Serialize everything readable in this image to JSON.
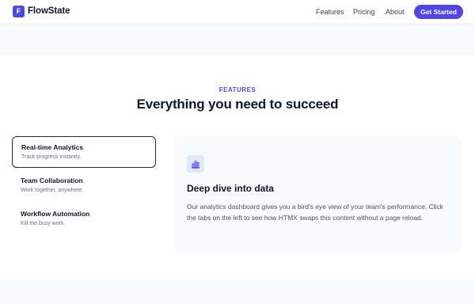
{
  "colors": {
    "accent": "#4f46e5",
    "accent_soft": "#e0e7ff",
    "text_dark": "#0f172a",
    "text_muted": "#64748b"
  },
  "nav": {
    "logo_letter": "F",
    "brand": "FlowState",
    "links": [
      "Features",
      "Pricing",
      "About"
    ],
    "cta": "Get Started"
  },
  "features": {
    "eyebrow": "FEATURES",
    "heading": "Everything you need to succeed",
    "tabs": [
      {
        "title": "Real-time Analytics",
        "description": "Track progress instantly.",
        "active": true
      },
      {
        "title": "Team Collaboration",
        "description": "Work together, anywhere.",
        "active": false
      },
      {
        "title": "Workflow Automation",
        "description": "Kill the busy work.",
        "active": false
      }
    ],
    "panel": {
      "icon": "bar-chart-icon",
      "title": "Deep dive into data",
      "body": "Our analytics dashboard gives you a bird's eye view of your team's performance. Click the tabs on the left to see how HTMX swaps this content without a page reload."
    }
  }
}
